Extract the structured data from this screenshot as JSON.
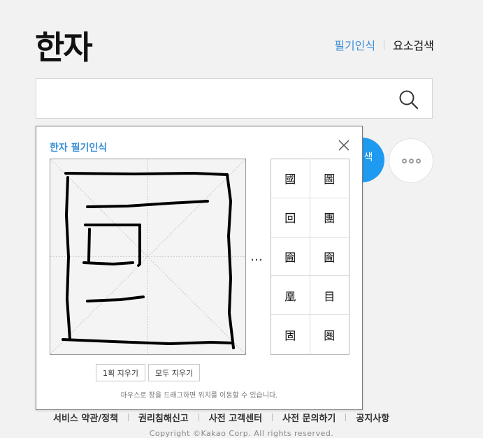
{
  "header": {
    "title": "한자",
    "nav": {
      "handwriting": "필기인식",
      "element_search": "요소검색"
    }
  },
  "search": {
    "value": "",
    "placeholder": ""
  },
  "side_button": {
    "label": "색"
  },
  "panel": {
    "title": "한자 필기인식",
    "ellipsis": "…",
    "candidates": [
      "國",
      "圖",
      "回",
      "團",
      "圇",
      "圇",
      "凰",
      "目",
      "固",
      "圏"
    ],
    "buttons": {
      "undo_stroke": "1획 지우기",
      "clear_all": "모두 지우기"
    },
    "hint": "마우스로 창을 드래그하면 위치를 이동할 수 있습니다."
  },
  "footer": {
    "links": [
      "서비스 약관/정책",
      "권리침해신고",
      "사전 고객센터",
      "사전 문의하기",
      "공지사항"
    ],
    "copyright": "Copyright ©Kakao Corp. All rights reserved."
  },
  "colors": {
    "accent": "#3a8fd8",
    "button_blue": "#1e9bf0"
  },
  "icons": {
    "search": "search-icon",
    "close": "close-icon",
    "more": "more-icon"
  }
}
